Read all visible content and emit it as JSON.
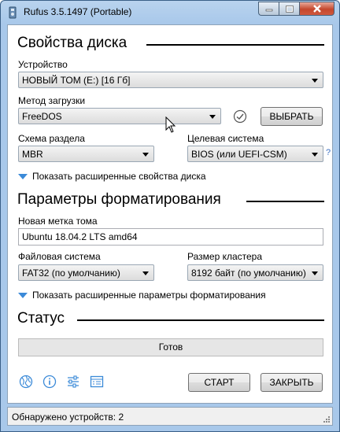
{
  "window": {
    "title": "Rufus 3.5.1497 (Portable)"
  },
  "drive_properties": {
    "heading": "Свойства диска",
    "device_label": "Устройство",
    "device_value": "НОВЫЙ ТОМ (E:) [16 Гб]",
    "boot_label": "Метод загрузки",
    "boot_value": "FreeDOS",
    "select_button": "ВЫБРАТЬ",
    "partition_label": "Схема раздела",
    "partition_value": "MBR",
    "target_label": "Целевая система",
    "target_value": "BIOS (или UEFI-CSM)",
    "target_help": "?",
    "advanced_toggle": "Показать расширенные свойства диска"
  },
  "format_options": {
    "heading": "Параметры форматирования",
    "volume_label_label": "Новая метка тома",
    "volume_label_value": "Ubuntu 18.04.2 LTS amd64",
    "filesystem_label": "Файловая система",
    "filesystem_value": "FAT32 (по умолчанию)",
    "cluster_label": "Размер кластера",
    "cluster_value": "8192 байт (по умолчанию)",
    "advanced_toggle": "Показать расширенные параметры форматирования"
  },
  "status": {
    "heading": "Статус",
    "progress_text": "Готов",
    "progress_value": 0
  },
  "actions": {
    "start_button": "СТАРТ",
    "close_button": "ЗАКРЫТЬ"
  },
  "status_bar": {
    "text": "Обнаружено устройств: 2"
  },
  "colors": {
    "accent_blue": "#3b8ad8",
    "titlebar": "#b9d3ee"
  }
}
